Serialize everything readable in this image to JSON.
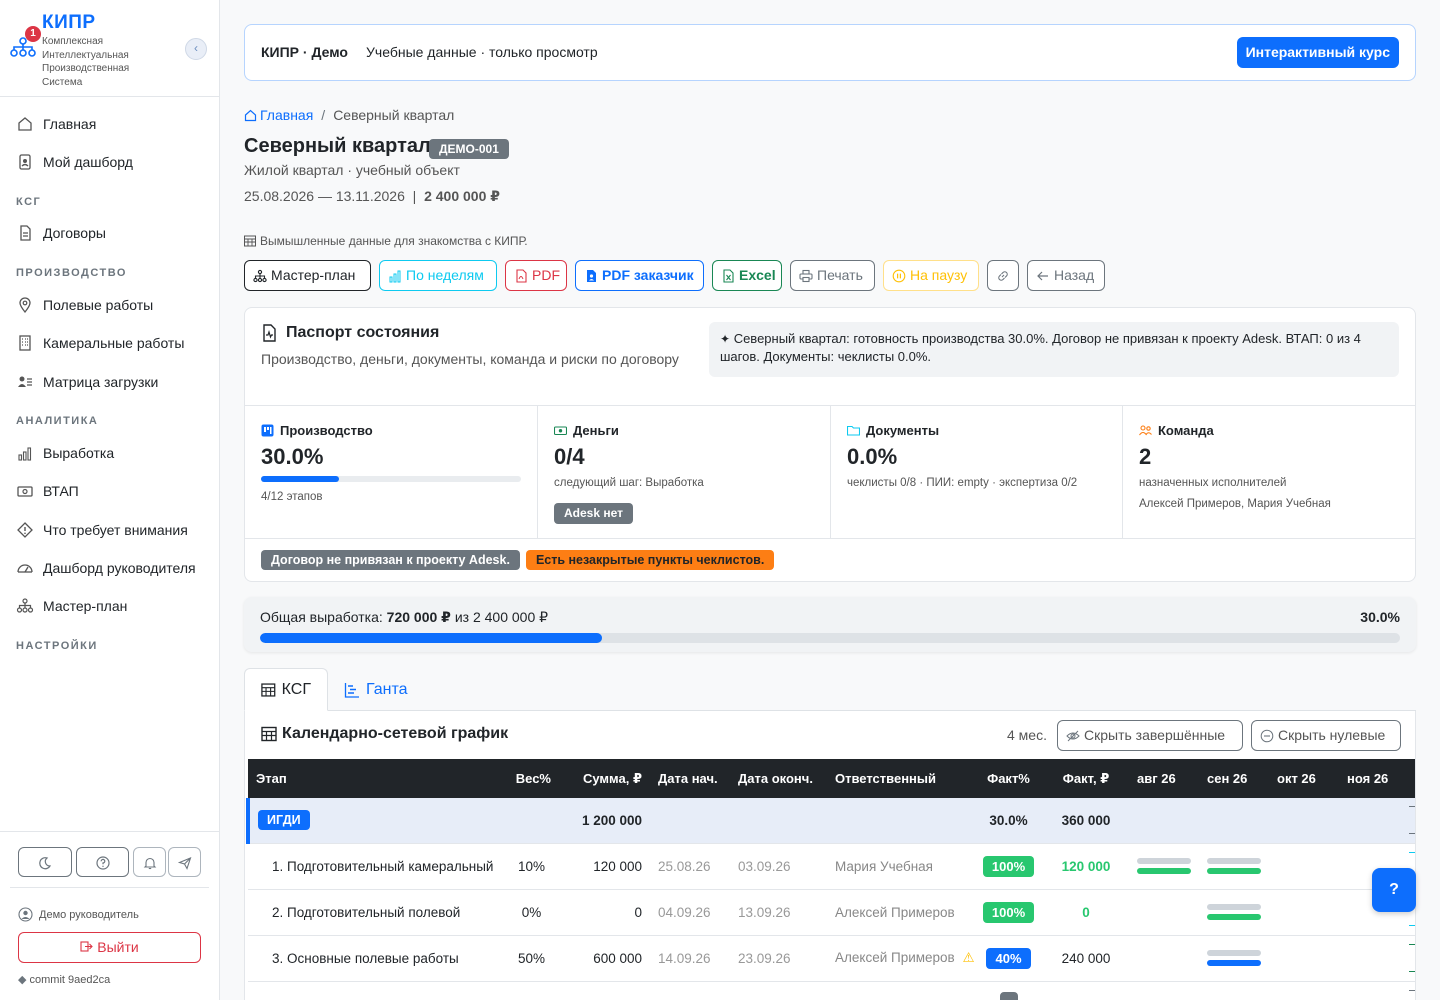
{
  "brand": {
    "title": "КИПР",
    "badge": "1",
    "subtitle": "Комплексная Интеллектуальная Производственная Система"
  },
  "sidebar": {
    "items_top": [
      {
        "label": "Главная",
        "icon": "home-icon"
      },
      {
        "label": "Мой дашборд",
        "icon": "person-badge-icon"
      }
    ],
    "sections": [
      {
        "title": "КСГ",
        "items": [
          {
            "label": "Договоры",
            "icon": "document-icon"
          }
        ]
      },
      {
        "title": "ПРОИЗВОДСТВО",
        "items": [
          {
            "label": "Полевые работы",
            "icon": "map-pin-icon"
          },
          {
            "label": "Камеральные работы",
            "icon": "building-icon"
          },
          {
            "label": "Матрица загрузки",
            "icon": "people-icon"
          }
        ]
      },
      {
        "title": "АНАЛИТИКА",
        "items": [
          {
            "label": "Выработка",
            "icon": "bar-chart-icon"
          },
          {
            "label": "ВТАП",
            "icon": "cash-icon"
          },
          {
            "label": "Что требует внимания",
            "icon": "warning-diamond-icon"
          },
          {
            "label": "Дашборд руководителя",
            "icon": "speedometer-icon"
          },
          {
            "label": "Мастер-план",
            "icon": "diagram-icon"
          }
        ]
      },
      {
        "title": "НАСТРОЙКИ",
        "items": []
      }
    ],
    "user": "Демо руководитель",
    "logout": "Выйти",
    "commit_label": "commit",
    "commit_hash": "9aed2ca"
  },
  "topbar": {
    "title": "КИПР · Демо",
    "subtitle": "Учебные данные · только просмотр",
    "course_button": "Интерактивный курс"
  },
  "breadcrumb": {
    "home": "Главная",
    "current": "Северный квартал"
  },
  "page": {
    "title": "Северный квартал",
    "code": "ДЕМО-001",
    "subtitle": "Жилой квартал · учебный объект",
    "dates": "25.08.2026 — 13.11.2026",
    "amount": "2 400 000 ₽",
    "demo_note": "Вымышленные данные для знакомства с КИПР."
  },
  "toolbar": {
    "master_plan": "Мастер-план",
    "by_weeks": "По неделям",
    "pdf": "PDF",
    "pdf_customer": "PDF заказчик",
    "excel": "Excel",
    "print": "Печать",
    "pause": "На паузу",
    "back": "Назад"
  },
  "passport": {
    "title": "Паспорт состояния",
    "subtitle": "Производство, деньги, документы, команда и риски по договору",
    "summary": "Северный квартал: готовность производства 30.0%. Договор не привязан к проекту Adesk. ВТАП: 0 из 4 шагов. Документы: чеклисты 0.0%.",
    "production": {
      "label": "Производство",
      "value": "30.0%",
      "progress": 0.3,
      "note": "4/12 этапов"
    },
    "money": {
      "label": "Деньги",
      "value": "0/4",
      "note": "следующий шаг: Выработка",
      "badge": "Adesk нет"
    },
    "documents": {
      "label": "Документы",
      "value": "0.0%",
      "note": "чеклисты 0/8 · ПИИ: empty · экспертиза 0/2"
    },
    "team": {
      "label": "Команда",
      "value": "2",
      "note": "назначенных исполнителей",
      "members": "Алексей Примеров, Мария Учебная"
    },
    "alerts": [
      {
        "text": "Договор не привязан к проекту Adesk.",
        "color": "#6c757d",
        "text_color": "#ffffff"
      },
      {
        "text": "Есть незакрытые пункты чеклистов.",
        "color": "#fd7e14",
        "text_color": "#212529"
      }
    ]
  },
  "overall": {
    "label": "Общая выработка:",
    "done": "720 000 ₽",
    "of": "из 2 400 000 ₽",
    "percent": "30.0%",
    "progress": 0.3
  },
  "tabs": [
    {
      "label": "КСГ",
      "active": true
    },
    {
      "label": "Ганта",
      "active": false
    }
  ],
  "ksg": {
    "title": "Календарно-сетевой график",
    "months": "4 мес.",
    "hide_done": "Скрыть завершённые",
    "hide_zero": "Скрыть нулевые",
    "columns": [
      "Этап",
      "Вес%",
      "Сумма, ₽",
      "Дата нач.",
      "Дата оконч.",
      "Ответственный",
      "Факт%",
      "Факт, ₽",
      "авг 26",
      "сен 26",
      "окт 26",
      "ноя 26"
    ],
    "group": {
      "name": "ИГДИ",
      "sum": "1 200 000",
      "fact_pct": "30.0%",
      "fact_sum": "360 000"
    },
    "rows": [
      {
        "name": "1. Подготовительный камеральный",
        "weight": "10%",
        "sum": "120 000",
        "start": "25.08.26",
        "end": "03.09.26",
        "owner": "Мария Учебная",
        "warn": false,
        "fact_pct": "100%",
        "fact_color": "#28c76f",
        "fact_sum": "120 000",
        "fact_sum_color": "#28c76f",
        "gantt": {
          "aug": "#28c76f",
          "sep": "#28c76f"
        }
      },
      {
        "name": "2. Подготовительный полевой",
        "weight": "0%",
        "sum": "0",
        "start": "04.09.26",
        "end": "13.09.26",
        "owner": "Алексей Примеров",
        "warn": false,
        "fact_pct": "100%",
        "fact_color": "#28c76f",
        "fact_sum": "0",
        "fact_sum_color": "#28c76f",
        "gantt": {
          "aug": null,
          "sep": "#28c76f"
        }
      },
      {
        "name": "3. Основные полевые работы",
        "weight": "50%",
        "sum": "600 000",
        "start": "14.09.26",
        "end": "23.09.26",
        "owner": "Алексей Примеров",
        "warn": true,
        "fact_pct": "40%",
        "fact_color": "#0d6efd",
        "fact_sum": "240 000",
        "fact_sum_color": "#212529",
        "gantt": {
          "aug": null,
          "sep": "#0d6efd"
        }
      }
    ]
  },
  "help_button": "?"
}
